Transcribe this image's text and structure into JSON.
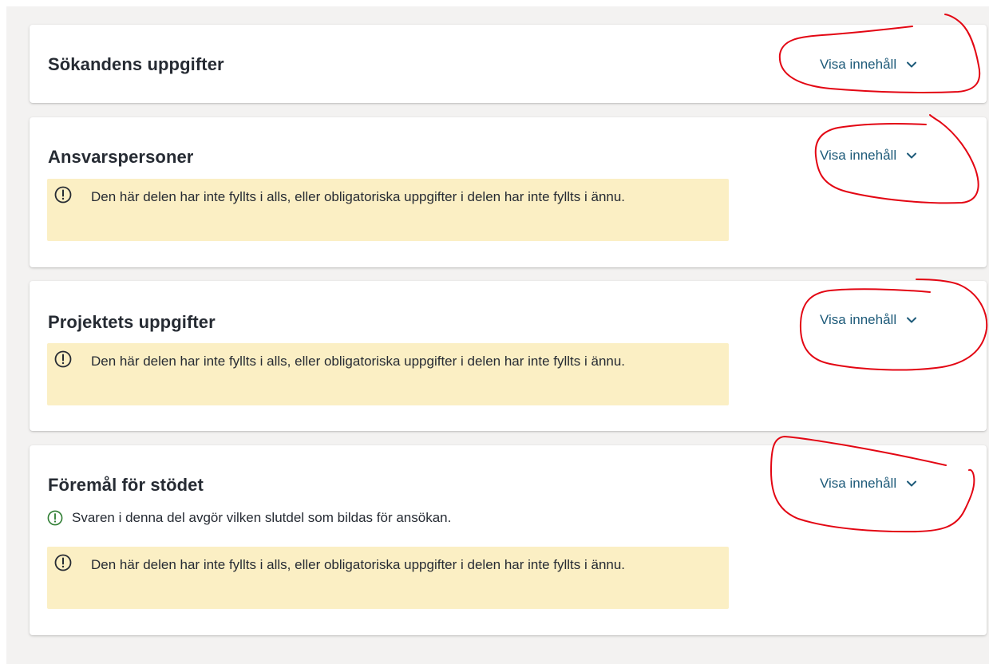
{
  "sections": [
    {
      "title": "Sökandens uppgifter",
      "toggle_label": "Visa innehåll"
    },
    {
      "title": "Ansvarspersoner",
      "toggle_label": "Visa innehåll",
      "warning": "Den här delen har inte fyllts i alls, eller obligatoriska uppgifter i delen har inte fyllts i ännu."
    },
    {
      "title": "Projektets uppgifter",
      "toggle_label": "Visa innehåll",
      "warning": "Den här delen har inte fyllts i alls, eller obligatoriska uppgifter i delen har inte fyllts i ännu."
    },
    {
      "title": "Föremål för stödet",
      "toggle_label": "Visa innehåll",
      "info": "Svaren i denna del avgör vilken slutdel som bildas för ansökan.",
      "warning": "Den här delen har inte fyllts i alls, eller obligatoriska uppgifter i delen har inte fyllts i ännu."
    }
  ],
  "colors": {
    "link": "#1d5a79",
    "warning_bg": "#fbefc4",
    "info_icon": "#2e7d32",
    "annotation": "#e30613"
  },
  "icons": {
    "toggle": "chevron-down-icon",
    "warning": "exclamation-circle-icon",
    "info": "info-circle-icon"
  }
}
